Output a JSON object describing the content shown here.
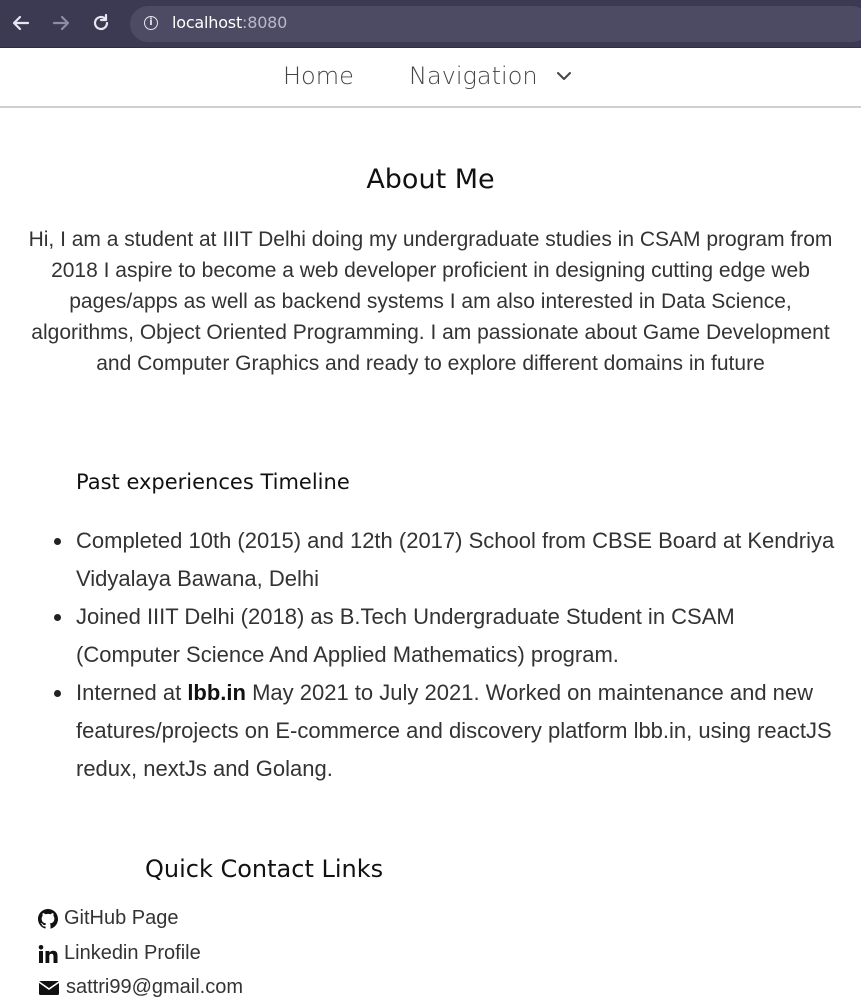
{
  "browser": {
    "url_host": "localhost",
    "url_port": ":8080"
  },
  "nav": {
    "home": "Home",
    "navigation": "Navigation"
  },
  "about": {
    "title": "About Me",
    "text": "Hi, I am a student at IIIT Delhi doing my undergraduate studies in CSAM program from 2018 I aspire to become a web developer proficient in designing cutting edge web pages/apps as well as backend systems I am also interested in Data Science, algorithms, Object Oriented Programming. I am passionate about Game Development and Computer Graphics and ready to explore different domains in future"
  },
  "timeline": {
    "title": "Past experiences Timeline",
    "items": [
      {
        "text": "Completed 10th (2015) and 12th (2017) School from CBSE Board at Kendriya Vidyalaya Bawana, Delhi"
      },
      {
        "text": "Joined IIIT Delhi (2018) as B.Tech Undergraduate Student in CSAM (Computer Science And Applied Mathematics) program."
      },
      {
        "prefix": "Interned at ",
        "bold": "lbb.in",
        "suffix": " May 2021 to July 2021. Worked on maintenance and new features/projects on E-commerce and discovery platform lbb.in, using reactJS redux, nextJs and Golang."
      }
    ]
  },
  "contact": {
    "title": "Quick Contact Links",
    "github": "GitHub Page",
    "linkedin": "Linkedin Profile",
    "email": "sattri99@gmail.com"
  },
  "icons": {
    "back": "arrow-left-icon",
    "forward": "arrow-right-icon",
    "reload": "reload-icon",
    "info": "info-icon",
    "chevron": "chevron-down-icon",
    "github": "github-icon",
    "linkedin": "linkedin-icon",
    "email": "envelope-icon"
  }
}
